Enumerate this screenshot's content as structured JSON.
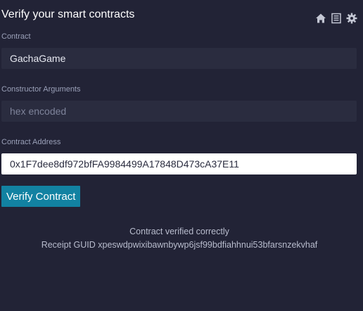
{
  "header": {
    "title": "Verify your smart contracts",
    "icons": [
      "home-icon",
      "document-icon",
      "gear-icon"
    ]
  },
  "form": {
    "contract": {
      "label": "Contract",
      "value": "GachaGame"
    },
    "constructor_args": {
      "label": "Constructor Arguments",
      "placeholder": "hex encoded",
      "value": ""
    },
    "contract_address": {
      "label": "Contract Address",
      "value": "0x1F7dee8df972bfFA9984499A17848D473cA37E11"
    },
    "submit_label": "Verify Contract"
  },
  "result": {
    "status": "Contract verified correctly",
    "receipt": "Receipt GUID xpeswdpwixibawnbywp6jsf99bdfiahhnui53bfarsnzekvhaf"
  },
  "colors": {
    "background": "#222336",
    "field": "#2a2c3f",
    "accent": "#1282a2"
  }
}
